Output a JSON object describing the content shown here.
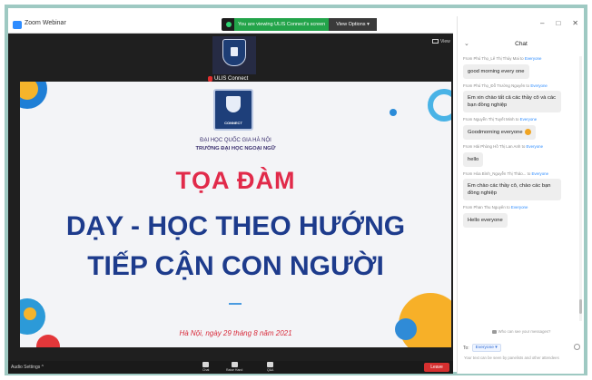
{
  "window": {
    "title": "Zoom Webinar",
    "banner_text": "You are viewing ULIS Connect's screen",
    "view_options": "View Options ▾",
    "view_button": "View"
  },
  "speaker": {
    "name": "ULIS Connect"
  },
  "slide": {
    "logo_text": "CONNECT",
    "university": "ĐẠI HỌC QUỐC GIA HÀ NỘI",
    "school": "TRƯỜNG ĐẠI HỌC NGOẠI NGỮ",
    "title_line1": "TỌA ĐÀM",
    "title_line2": "DẠY - HỌC THEO HƯỚNG",
    "title_line3": "TIẾP CẬN CON NGƯỜI",
    "date": "Hà Nội, ngày 29 tháng 8 năm 2021"
  },
  "toolbar": {
    "audio_settings": "Audio Settings ^",
    "items": [
      {
        "label": "Chat",
        "icon": "chat-icon"
      },
      {
        "label": "Raise Hand",
        "icon": "raise-hand-icon"
      },
      {
        "label": "Q&A",
        "icon": "qa-icon"
      }
    ],
    "leave": "Leave"
  },
  "chat": {
    "controls": [
      "–",
      "□",
      "✕"
    ],
    "back": "⌄",
    "title": "Chat",
    "messages": [
      {
        "from": "From Phú Thọ_Lê Thị Thúy Mai to ",
        "to": "Everyone",
        "text": "good morning every one",
        "emoji": false
      },
      {
        "from": "From Phú Thọ_Đỗ Trường Nguyên to ",
        "to": "Everyone",
        "text": "Em xin chào tất cả các thầy cô và các bạn đồng nghiệp",
        "emoji": false
      },
      {
        "from": "From Nguyễn Thị Tuyết Minh to ",
        "to": "Everyone",
        "text": "Goodmorning everyone",
        "emoji": true
      },
      {
        "from": "From Hải Phòng Hồ Thị Lan Anh to ",
        "to": "Everyone",
        "text": "hello",
        "emoji": false
      },
      {
        "from": "From Hòa Bình_Nguyễn Thị Thảo... to ",
        "to": "Everyone",
        "text": "Em chào các thầy cô, chào các bạn đồng nghiệp",
        "emoji": false
      },
      {
        "from": "From Phan Thu Nguyên to ",
        "to": "Everyone",
        "text": "Hello everyone",
        "emoji": false
      }
    ],
    "who_can_see": "Who can see your messages?",
    "to_label": "To:",
    "to_value": "Everyone ▾",
    "input_hint": "Your text can be seen by panelists and other attendees"
  }
}
